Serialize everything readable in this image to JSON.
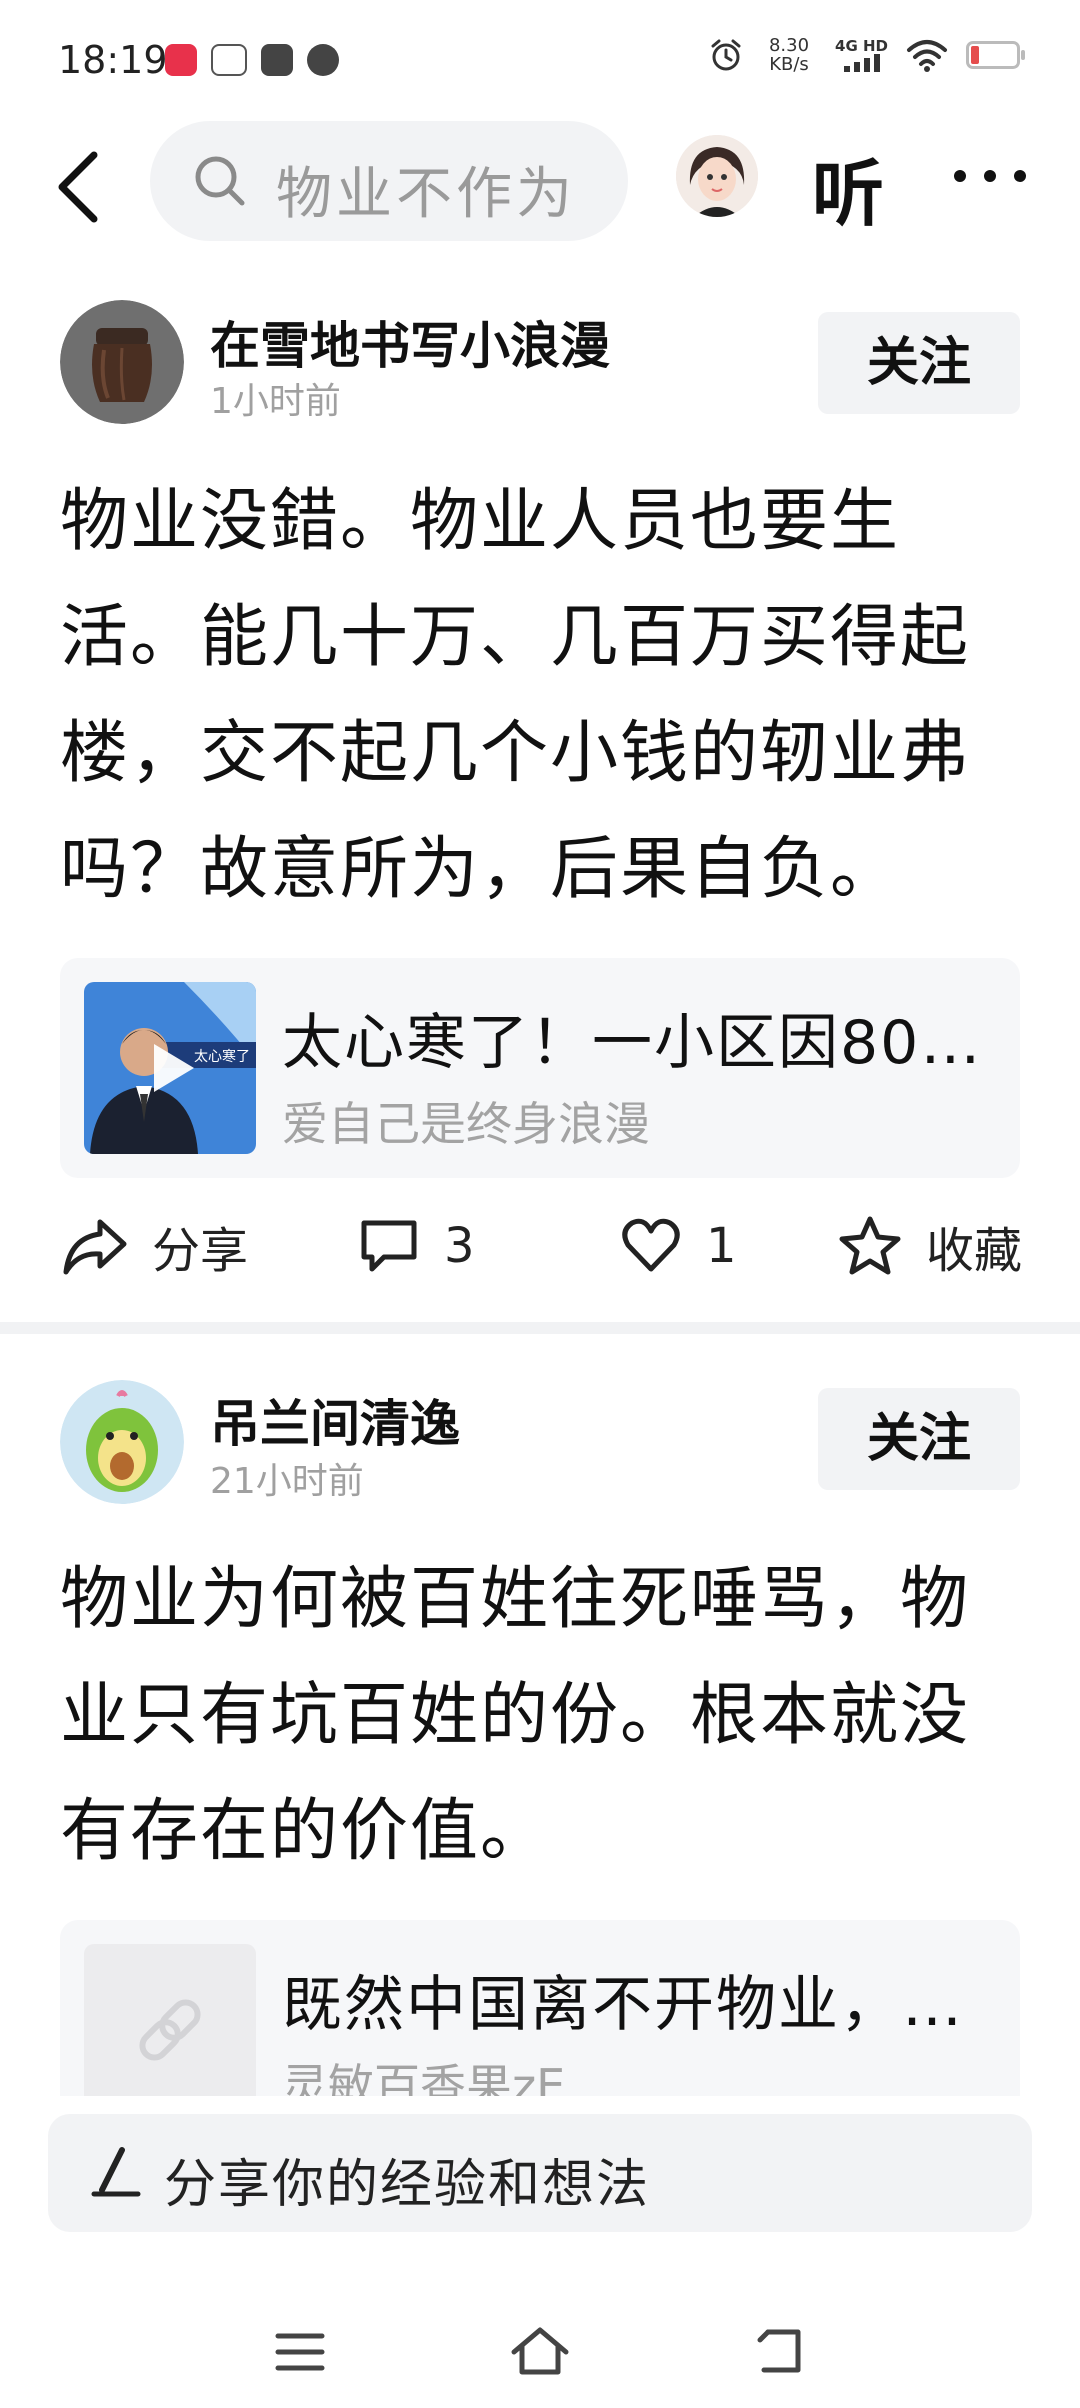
{
  "status_bar": {
    "time": "18:19",
    "net_speed_value": "8.30",
    "net_speed_unit": "KB/s",
    "net_type": "4G HD"
  },
  "top_nav": {
    "search_placeholder": "物业不作为",
    "listen_label": "听"
  },
  "posts": [
    {
      "author": "在雪地书写小浪漫",
      "time": "1小时前",
      "follow_label": "关注",
      "text": "物业没錯。物业人员也要生活。能几十万、几百万买得起楼，交不起几个小钱的轫业弗吗？故意所为，后果自负。",
      "link_card": {
        "title": "太心寒了！一小区因80…",
        "source": "爱自己是终身浪漫",
        "thumb_caption": "太心寒了"
      },
      "actions": {
        "share_label": "分享",
        "comment_count": "3",
        "like_count": "1",
        "favorite_label": "收藏"
      }
    },
    {
      "author": "吊兰间清逸",
      "time": "21小时前",
      "follow_label": "关注",
      "text": "物业为何被百姓往死唾骂，物业只有坑百姓的份。根本就没有存在的价值。",
      "link_card": {
        "title": "既然中国离不开物业，…",
        "source": "灵敏百香果zE"
      }
    }
  ],
  "composer": {
    "placeholder": "分享你的经验和想法"
  },
  "colors": {
    "follow_bg": "#f2f3f5",
    "card_bg": "#f6f7f9",
    "muted_text": "#a0a0a0",
    "battery_low": "#e54d4d"
  }
}
